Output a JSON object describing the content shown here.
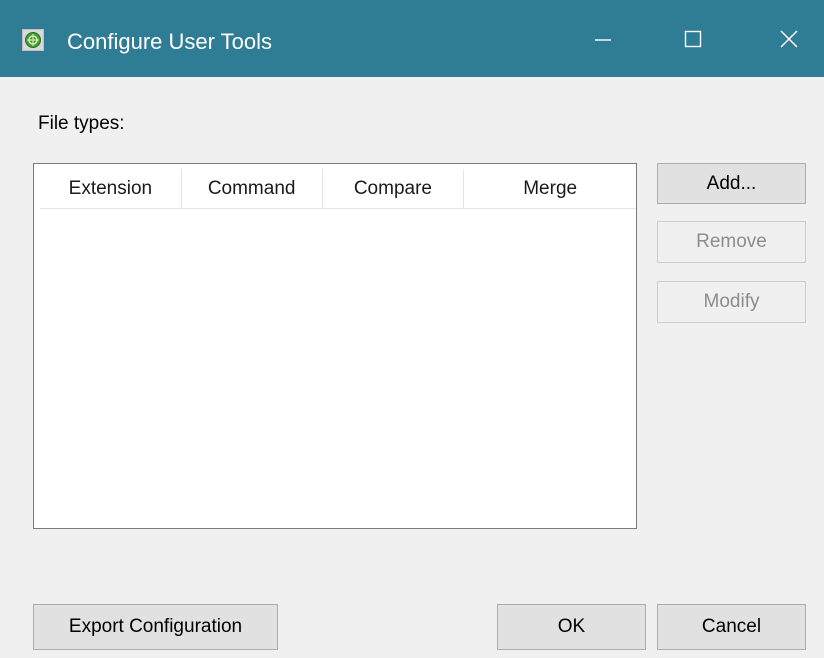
{
  "window": {
    "title": "Configure User Tools",
    "icon": "app-logo-icon",
    "controls": {
      "minimize_icon": "minimize-icon",
      "maximize_icon": "maximize-icon",
      "close_icon": "close-icon"
    },
    "titlebar_color": "#2e7d95"
  },
  "filetypes": {
    "label": "File types:",
    "columns": [
      "Extension",
      "Command",
      "Compare",
      "Merge"
    ],
    "rows": []
  },
  "side_buttons": {
    "add": "Add...",
    "remove": "Remove",
    "modify": "Modify"
  },
  "footer": {
    "export": "Export Configuration",
    "ok": "OK",
    "cancel": "Cancel"
  }
}
